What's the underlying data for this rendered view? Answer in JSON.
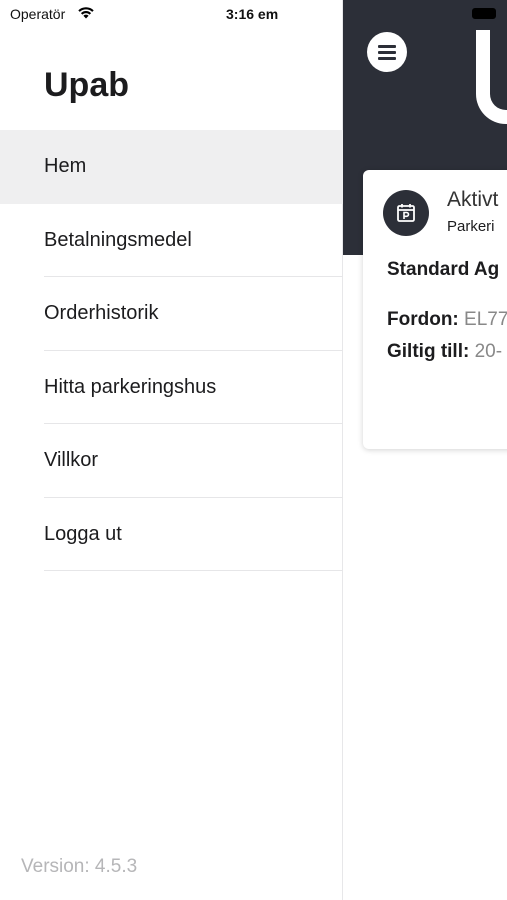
{
  "status_bar": {
    "carrier": "Operatör",
    "time": "3:16 em"
  },
  "drawer": {
    "title": "Upab",
    "menu": [
      {
        "label": "Hem",
        "active": true
      },
      {
        "label": "Betalningsmedel",
        "active": false
      },
      {
        "label": "Orderhistorik",
        "active": false
      },
      {
        "label": "Hitta parkeringshus",
        "active": false
      },
      {
        "label": "Villkor",
        "active": false
      },
      {
        "label": "Logga ut",
        "active": false
      }
    ],
    "version": "Version: 4.5.3"
  },
  "main": {
    "header_color": "#2c2f38",
    "card": {
      "title": "Aktivt",
      "subtitle": "Parkeri",
      "product": "Standard Ag",
      "vehicle_label": "Fordon:",
      "vehicle_value": "EL77",
      "valid_label": "Giltig till:",
      "valid_value": "20-"
    }
  },
  "icons": {
    "wifi": "wifi-icon",
    "battery": "battery-icon",
    "menu": "hamburger-icon",
    "parking": "parking-calendar-icon"
  }
}
